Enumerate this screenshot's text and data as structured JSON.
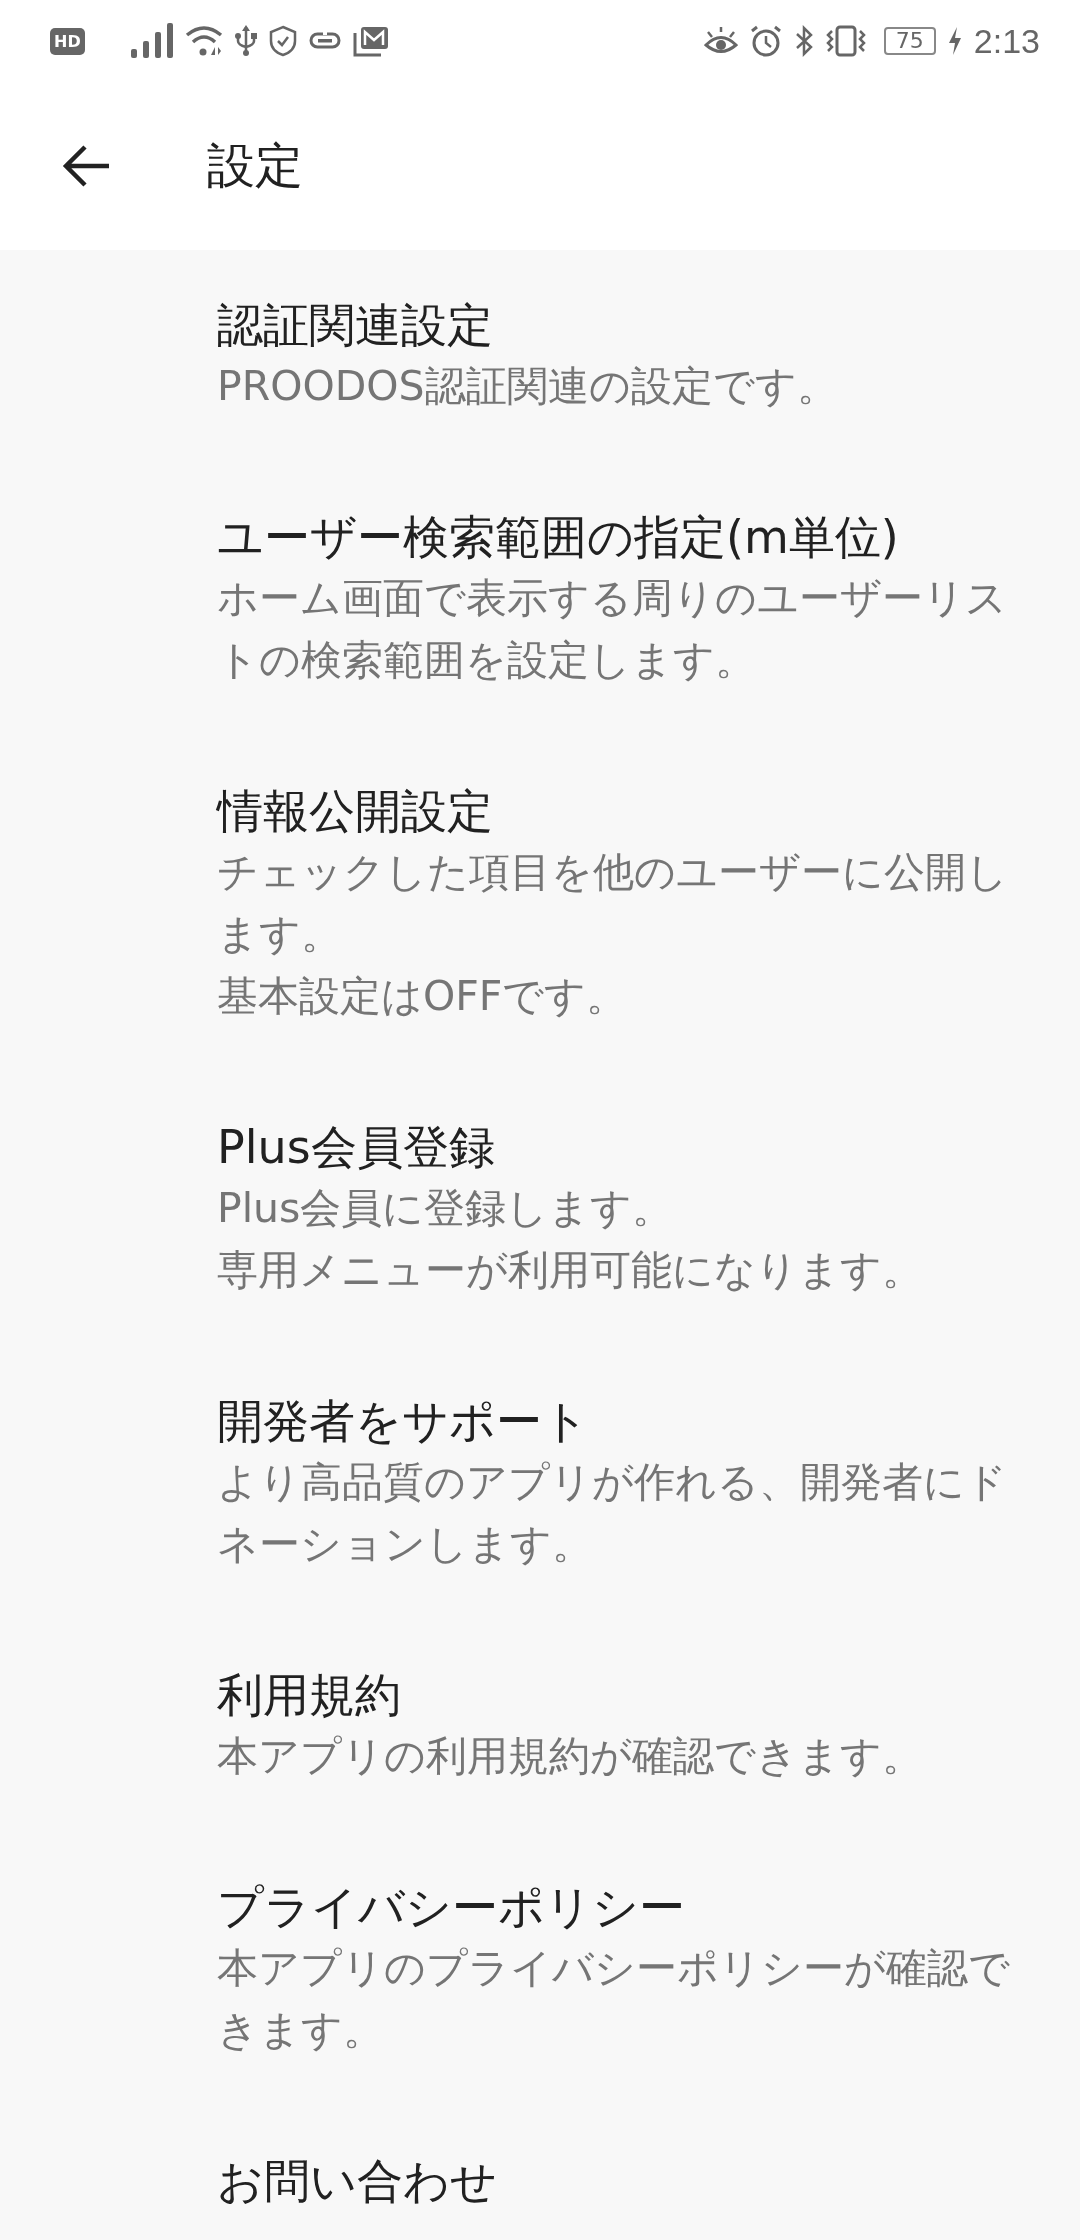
{
  "status_bar": {
    "hd_badge": "HD",
    "battery": "75",
    "time": "2:13"
  },
  "app_bar": {
    "title": "設定"
  },
  "settings": [
    {
      "title": "認証関連設定",
      "description": [
        "PROODOS認証関連の設定です。"
      ]
    },
    {
      "title": "ユーザー検索範囲の指定(m単位)",
      "description": [
        "ホーム画面で表示する周りのユーザーリス",
        "トの検索範囲を設定します。"
      ]
    },
    {
      "title": "情報公開設定",
      "description": [
        "チェックした項目を他のユーザーに公開し",
        "ます。",
        "基本設定はOFFです。"
      ]
    },
    {
      "title": "Plus会員登録",
      "description": [
        "Plus会員に登録します。",
        "専用メニューが利用可能になります。"
      ]
    },
    {
      "title": "開発者をサポート",
      "description": [
        "より高品質のアプリが作れる、開発者にド",
        "ネーションします。"
      ]
    },
    {
      "title": "利用規約",
      "description": [
        "本アプリの利用規約が確認できます。"
      ]
    },
    {
      "title": "プライバシーポリシー",
      "description": [
        "本アプリのプライバシーポリシーが確認で",
        "きます。"
      ]
    },
    {
      "title": "お問い合わせ"
    }
  ]
}
